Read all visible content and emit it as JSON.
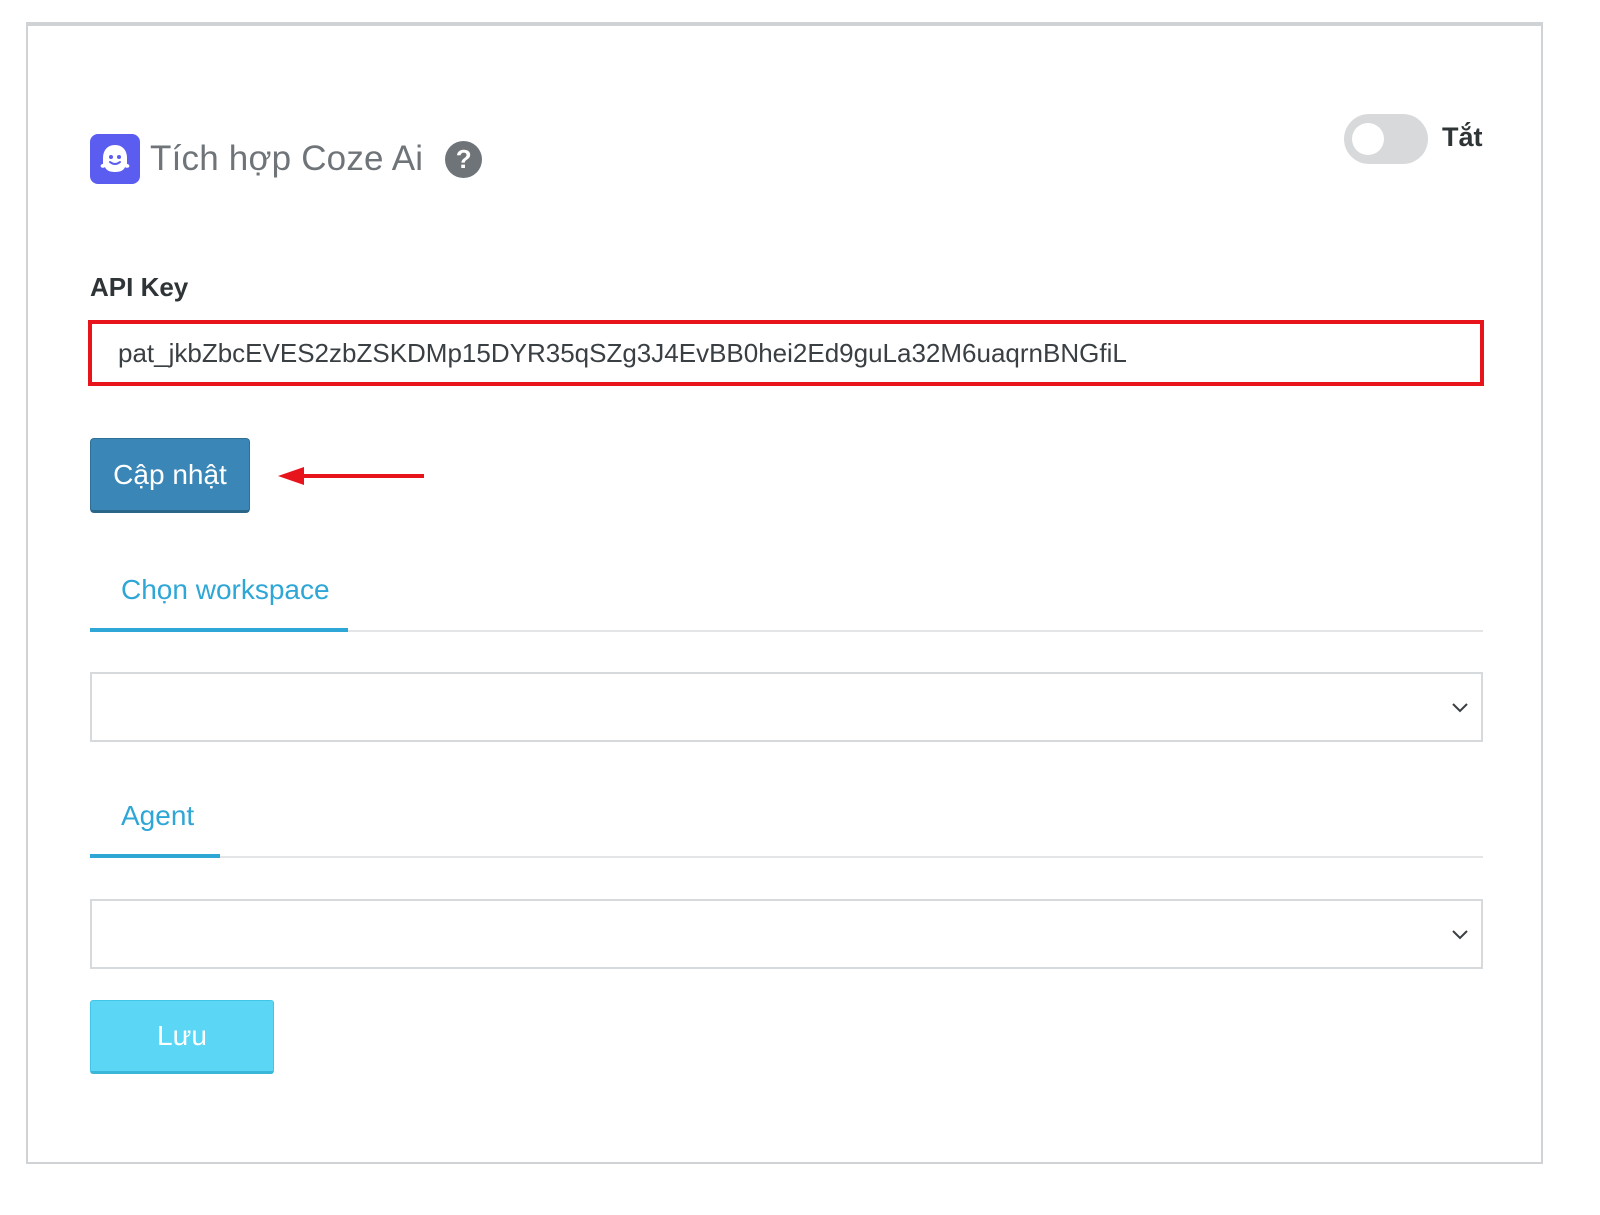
{
  "integration": {
    "title": "Tích hợp Coze Ai",
    "help_glyph": "?",
    "toggle_label": "Tắt",
    "toggle_on": false
  },
  "api_key": {
    "label": "API Key",
    "value": "pat_jkbZbcEVES2zbZSKDMp15DYR35qSZg3J4EvBB0hei2Ed9guLa32M6uaqrnBNGfiL"
  },
  "buttons": {
    "update": "Cập nhật",
    "save": "Lưu"
  },
  "tabs": {
    "workspace": "Chọn workspace",
    "agent": "Agent"
  },
  "selects": {
    "workspace_value": "",
    "agent_value": ""
  },
  "icons": [
    "coze-ghost-icon",
    "help-icon",
    "chevron-down-icon",
    "red-arrow-annotation"
  ],
  "colors": {
    "app_icon_bg": "#5b5cf0",
    "highlight_red": "#e8141c",
    "update_button": "#3a87b7",
    "save_button": "#5bd6f5",
    "tab_accent": "#2ea6d6",
    "toggle_off": "#d7d9db"
  }
}
